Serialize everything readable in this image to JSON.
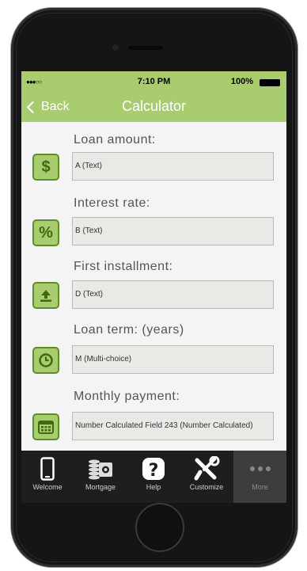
{
  "status_bar": {
    "signal": "●●●○○",
    "time": "7:10 PM",
    "battery": "100%"
  },
  "nav": {
    "back_label": "Back",
    "title": "Calculator"
  },
  "fields": [
    {
      "label": "Loan amount:",
      "value": "A (Text)",
      "icon": "dollar-icon"
    },
    {
      "label": "Interest rate:",
      "value": "B (Text)",
      "icon": "percent-icon"
    },
    {
      "label": "First installment:",
      "value": "D (Text)",
      "icon": "upload-icon"
    },
    {
      "label": "Loan term: (years)",
      "value": "M (Multi-choice)",
      "icon": "clock-icon"
    },
    {
      "label": "Monthly payment:",
      "value": "Number Calculated Field 243 (Number Calculated)",
      "icon": "calendar-icon"
    }
  ],
  "tabs": [
    {
      "label": "Welcome",
      "icon": "phone-icon"
    },
    {
      "label": "Mortgage",
      "icon": "money-icon"
    },
    {
      "label": "Help",
      "icon": "question-icon"
    },
    {
      "label": "Customize",
      "icon": "tools-icon"
    },
    {
      "label": "More",
      "icon": "more-icon",
      "active": true
    }
  ],
  "colors": {
    "accent": "#a9cc6f",
    "icon_border": "#5e8e2a",
    "tabbar": "#1e1e1e"
  }
}
